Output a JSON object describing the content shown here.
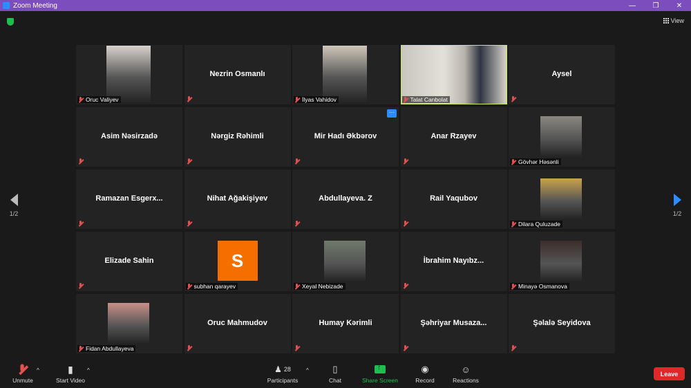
{
  "window": {
    "title": "Zoom Meeting"
  },
  "view_label": "View",
  "pager": {
    "left": "1/2",
    "right": "1/2"
  },
  "participants": [
    {
      "name": "Oruc Valiyev",
      "display": "photo",
      "photo": "#d8d2cc",
      "overlay_name": false
    },
    {
      "name": "Nezrin Osmanlı",
      "display": "name"
    },
    {
      "name": "İlyas Vahidov",
      "display": "photo",
      "photo": "#cfc6b9",
      "overlay_name": false
    },
    {
      "name": "Talat Canbolat",
      "display": "photo-full",
      "active": true
    },
    {
      "name": "Aysel",
      "display": "name"
    },
    {
      "name": "Asim Nəsirzadə",
      "display": "name"
    },
    {
      "name": "Nərgiz Rəhimli",
      "display": "name"
    },
    {
      "name": "Mir Hadı Əkbərov",
      "display": "name",
      "more": true
    },
    {
      "name": "Anar Rzayev",
      "display": "name"
    },
    {
      "name": "Gövhər Həsənli",
      "display": "photo-small",
      "photo": "#8a8780"
    },
    {
      "name": "Ramazan  Esgerx...",
      "display": "name"
    },
    {
      "name": "Nihat Ağakişiyev",
      "display": "name"
    },
    {
      "name": "Abdullayeva. Z",
      "display": "name"
    },
    {
      "name": "Rail Yaqubov",
      "display": "name"
    },
    {
      "name": "Dilara Quluzade",
      "display": "photo-small",
      "photo": "#c9a24a"
    },
    {
      "name": "Elizade Sahin",
      "display": "name"
    },
    {
      "name": "subhan qarayev",
      "display": "avatar",
      "initial": "S"
    },
    {
      "name": "Xeyal Nebizade",
      "display": "photo-small",
      "photo": "#6f7a6a"
    },
    {
      "name": "İbrahim  Nayıbz...",
      "display": "name"
    },
    {
      "name": "Minayə Osmanova",
      "display": "photo-small",
      "photo": "#3b2d2a"
    },
    {
      "name": "Fidan Abdullayeva",
      "display": "photo-small",
      "photo": "#c98f88"
    },
    {
      "name": "Oruc Mahmudov",
      "display": "name"
    },
    {
      "name": "Humay Kərimli",
      "display": "name"
    },
    {
      "name": "Şəhriyar  Musaza...",
      "display": "name"
    },
    {
      "name": "Şəlalə Seyidova",
      "display": "name"
    }
  ],
  "toolbar": {
    "unmute": "Unmute",
    "start_video": "Start Video",
    "participants": "Participants",
    "participants_count": "28",
    "chat": "Chat",
    "share_screen": "Share Screen",
    "record": "Record",
    "reactions": "Reactions",
    "leave": "Leave"
  },
  "colors": {
    "titlebar": "#7c4dbc",
    "active_border": "#c6e85a",
    "share": "#1fbf4f",
    "leave": "#e02828",
    "accent": "#2d8cff"
  }
}
